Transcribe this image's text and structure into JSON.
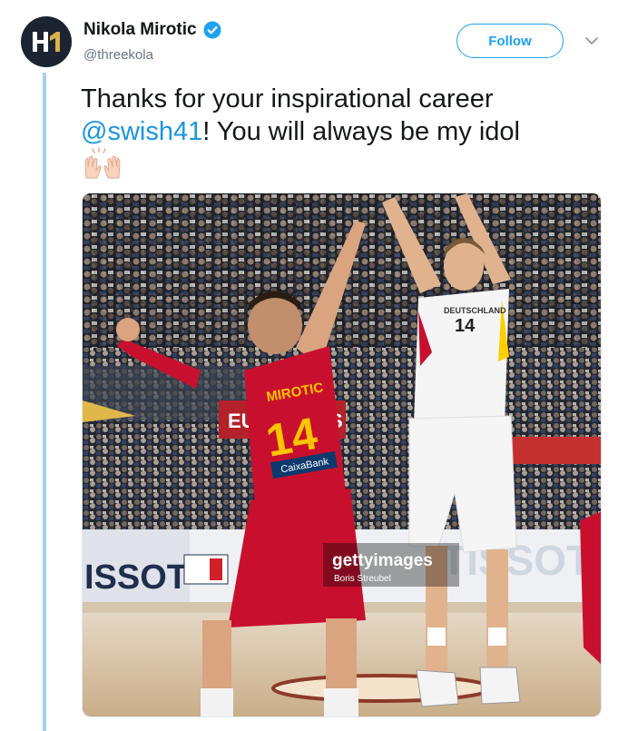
{
  "tweet": {
    "display_name": "Nikola Mirotic",
    "handle": "@threekola",
    "follow_label": "Follow",
    "text_before": "Thanks for your inspirational career ",
    "mention": "@swish41",
    "text_after": "! You will always be my idol",
    "emoji": "raised-hands-emoji"
  },
  "media": {
    "description_icon": "basketball-photo",
    "left_player_name": "MIROTIC",
    "left_player_number": "14",
    "left_sponsor": "CaixaBank",
    "right_player_team": "DEUTSCHLAND",
    "right_player_number": "14",
    "board_left": "ISSOT",
    "board_right": "TISSOT",
    "board_mid": "EU",
    "board_mid_red": "S",
    "getty_logo": "gettyimages",
    "photographer": "Boris Streubel"
  },
  "colors": {
    "accent": "#1da1f2",
    "thread": "#a8d0ea",
    "spain_red": "#c8102e",
    "spain_yellow": "#ffc400"
  }
}
